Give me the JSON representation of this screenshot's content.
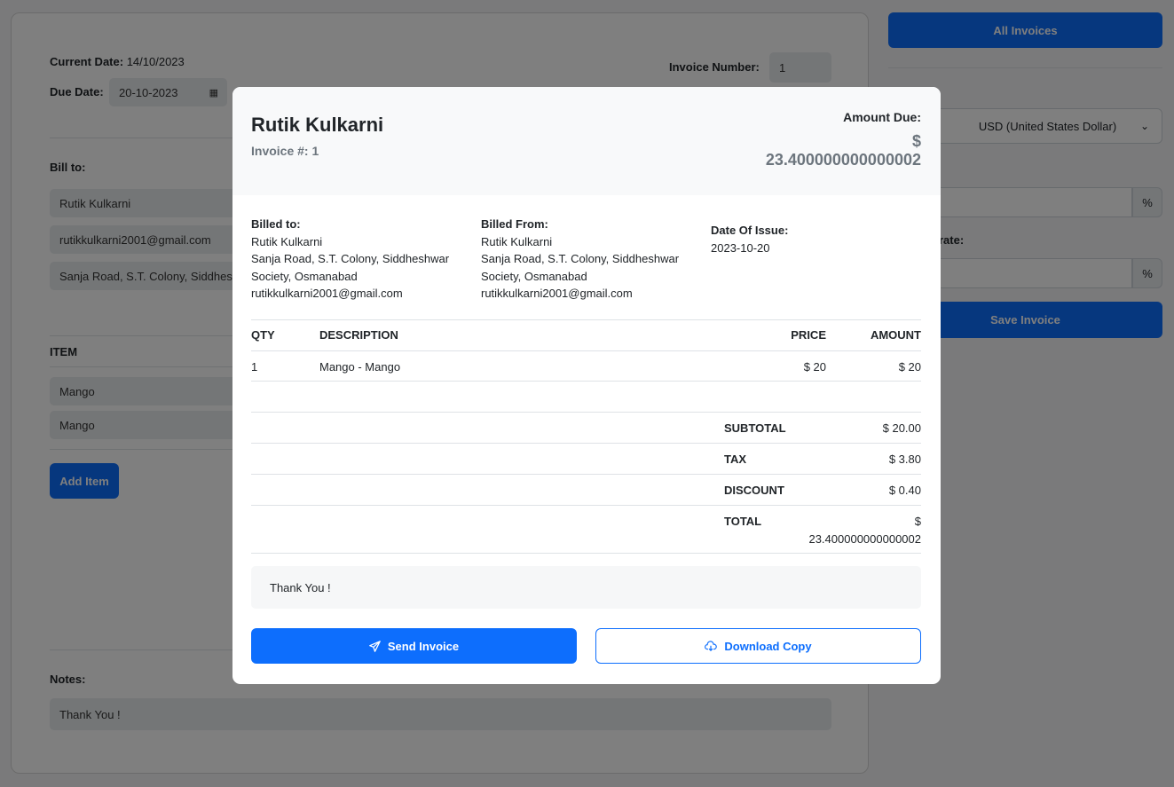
{
  "form": {
    "current_date_label": "Current Date:",
    "current_date": "14/10/2023",
    "due_date_label": "Due Date:",
    "due_date": "20-10-2023",
    "invoice_number_label": "Invoice Number:",
    "invoice_number": "1",
    "bill_to_label": "Bill to:",
    "bill_to_name": "Rutik Kulkarni",
    "bill_to_email": "rutikkulkarni2001@gmail.com",
    "bill_to_address": "Sanja Road, S.T. Colony, Siddheshw",
    "item_header": "ITEM",
    "item_name": "Mango",
    "item_description": "Mango",
    "add_item_label": "Add Item",
    "notes_label": "Notes:",
    "notes_value": "Thank You !"
  },
  "sidebar": {
    "all_invoices_label": "All Invoices",
    "currency_value": "USD (United States Dollar)",
    "tax_suffix": "%",
    "discount_label_partial": "rate:",
    "discount_suffix": "%",
    "save_invoice_label": "Save Invoice"
  },
  "modal": {
    "name": "Rutik Kulkarni",
    "invoice_no": "Invoice #: 1",
    "amount_due_label": "Amount Due:",
    "amount_due_currency": "$",
    "amount_due_value": "23.400000000000002",
    "billed_to": {
      "heading": "Billed to:",
      "name": "Rutik Kulkarni",
      "address_line1": "Sanja Road, S.T. Colony, Siddheshwar",
      "address_line2": "Society, Osmanabad",
      "email": "rutikkulkarni2001@gmail.com"
    },
    "billed_from": {
      "heading": "Billed From:",
      "name": "Rutik Kulkarni",
      "address_line1": "Sanja Road, S.T. Colony, Siddheshwar",
      "address_line2": "Society, Osmanabad",
      "email": "rutikkulkarni2001@gmail.com"
    },
    "date_of_issue_label": "Date Of Issue:",
    "date_of_issue": "2023-10-20",
    "table": {
      "headers": {
        "qty": "QTY",
        "description": "DESCRIPTION",
        "price": "PRICE",
        "amount": "AMOUNT"
      },
      "rows": [
        {
          "qty": "1",
          "description": "Mango - Mango",
          "price": "$ 20",
          "amount": "$ 20"
        }
      ]
    },
    "totals": {
      "subtotal_label": "SUBTOTAL",
      "subtotal": "$ 20.00",
      "tax_label": "TAX",
      "tax": "$ 3.80",
      "discount_label": "DISCOUNT",
      "discount": "$ 0.40",
      "total_label": "TOTAL",
      "total_currency": "$",
      "total_value": "23.400000000000002"
    },
    "notes": "Thank You !",
    "send_label": "Send Invoice",
    "download_label": "Download Copy"
  },
  "colors": {
    "primary": "#0d6efd",
    "overlay": "rgba(0,0,0,0.5)"
  }
}
